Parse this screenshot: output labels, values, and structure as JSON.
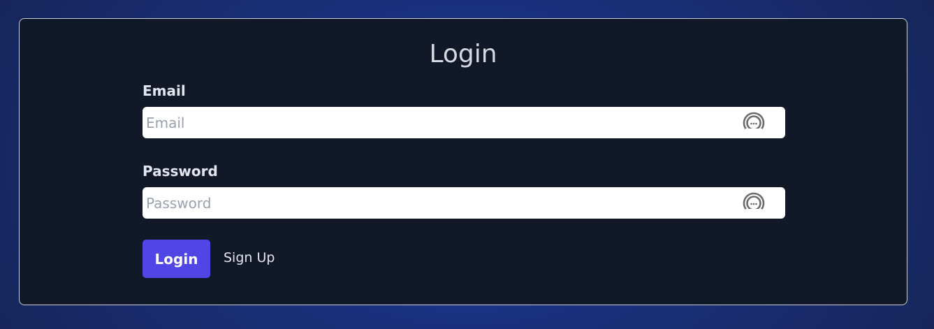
{
  "title": "Login",
  "email": {
    "label": "Email",
    "placeholder": "Email",
    "value": "",
    "icon": "password-manager-icon"
  },
  "password": {
    "label": "Password",
    "placeholder": "Password",
    "value": "",
    "icon": "password-manager-icon"
  },
  "actions": {
    "login_label": "Login",
    "signup_label": "Sign Up"
  },
  "colors": {
    "background": "#1e3fae",
    "card": "#111827",
    "accent": "#4f46e5",
    "text": "#e2e6ee"
  }
}
